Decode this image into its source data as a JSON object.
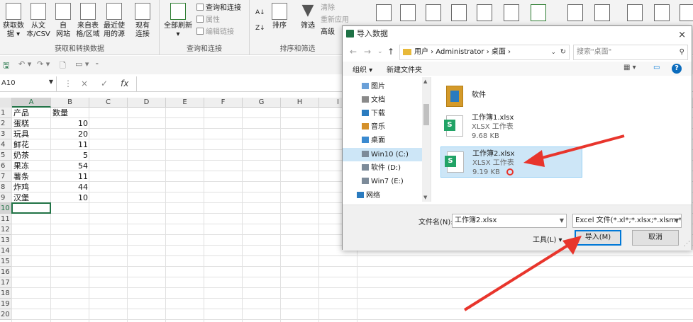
{
  "ribbon": {
    "get_transform": {
      "buttons": [
        {
          "label1": "获取数",
          "label2": "据 ▾"
        },
        {
          "label1": "从文",
          "label2": "本/CSV"
        },
        {
          "label1": "自",
          "label2": "网站"
        },
        {
          "label1": "来自表",
          "label2": "格/区域"
        },
        {
          "label1": "最近使",
          "label2": "用的源"
        },
        {
          "label1": "现有",
          "label2": "连接"
        }
      ],
      "label": "获取和转换数据"
    },
    "queries": {
      "refresh1": "全部刷新",
      "refresh2": "▾",
      "items": [
        "查询和连接",
        "属性",
        "编辑链接"
      ],
      "label": "查询和连接"
    },
    "sort_filter": {
      "sort": "排序",
      "filter": "筛选",
      "clear": "清除",
      "reapply": "重新应用",
      "advanced": "高级",
      "label": "排序和筛选"
    }
  },
  "quick_access": {
    "save": "🖫",
    "undo": "↶ ▾",
    "redo": "↷ ▾",
    "preview": "🗋",
    "more": "▭ ▾",
    "customize": "⁃"
  },
  "formula_bar": {
    "name_box": "A10",
    "cancel": "×",
    "enter": "✓",
    "fx": "fx",
    "value": ""
  },
  "sheet": {
    "columns": [
      "A",
      "B",
      "C",
      "D",
      "E",
      "F",
      "G",
      "H",
      "I"
    ],
    "selected_col": "A",
    "rows": [
      {
        "n": "1",
        "a": "产品",
        "b": "数量"
      },
      {
        "n": "2",
        "a": "蛋糕",
        "b": "10"
      },
      {
        "n": "3",
        "a": "玩具",
        "b": "20"
      },
      {
        "n": "4",
        "a": "鲜花",
        "b": "11"
      },
      {
        "n": "5",
        "a": "奶茶",
        "b": "5"
      },
      {
        "n": "6",
        "a": "果冻",
        "b": "54"
      },
      {
        "n": "7",
        "a": "薯条",
        "b": "11"
      },
      {
        "n": "8",
        "a": "炸鸡",
        "b": "44"
      },
      {
        "n": "9",
        "a": "汉堡",
        "b": "10"
      },
      {
        "n": "10",
        "a": "",
        "b": ""
      },
      {
        "n": "11",
        "a": "",
        "b": ""
      },
      {
        "n": "12",
        "a": "",
        "b": ""
      },
      {
        "n": "13",
        "a": "",
        "b": ""
      },
      {
        "n": "14",
        "a": "",
        "b": ""
      },
      {
        "n": "15",
        "a": "",
        "b": ""
      },
      {
        "n": "16",
        "a": "",
        "b": ""
      },
      {
        "n": "17",
        "a": "",
        "b": ""
      },
      {
        "n": "18",
        "a": "",
        "b": ""
      },
      {
        "n": "19",
        "a": "",
        "b": ""
      },
      {
        "n": "20",
        "a": "",
        "b": ""
      }
    ],
    "selected_row": "10"
  },
  "dialog": {
    "title": "导入数据",
    "close": "×",
    "nav": {
      "back": "←",
      "forward": "→",
      "dropdown": "⌄",
      "up": "↑"
    },
    "breadcrumb": "用户 › Administrator › 桌面 ›",
    "breadcrumb_dropdown": "⌄",
    "refresh": "↻",
    "search_placeholder": "搜索\"桌面\"",
    "search_icon": "⚲",
    "toolbar": {
      "organize": "组织 ▾",
      "new_folder": "新建文件夹",
      "view": "▦ ▾",
      "pane": "▭",
      "help": "?"
    },
    "nav_items": [
      {
        "label": "图片",
        "icon": "pictures-icon"
      },
      {
        "label": "文档",
        "icon": "documents-icon"
      },
      {
        "label": "下载",
        "icon": "downloads-icon"
      },
      {
        "label": "音乐",
        "icon": "music-icon"
      },
      {
        "label": "桌面",
        "icon": "desktop-icon"
      },
      {
        "label": "Win10 (C:)",
        "icon": "drive-icon"
      },
      {
        "label": "软件 (D:)",
        "icon": "drive-icon"
      },
      {
        "label": "Win7 (E:)",
        "icon": "drive-icon"
      },
      {
        "label": "网络",
        "icon": "network-icon"
      }
    ],
    "selected_nav": "Win10 (C:)",
    "files": [
      {
        "name": "软件",
        "type": "",
        "size": ""
      },
      {
        "name": "工作簿1.xlsx",
        "type": "XLSX 工作表",
        "size": "9.68 KB"
      },
      {
        "name": "工作簿2.xlsx",
        "type": "XLSX 工作表",
        "size": "9.19 KB"
      }
    ],
    "selected_file": "工作簿2.xlsx",
    "filename_label": "文件名(N):",
    "filename_value": "工作簿2.xlsx",
    "filetype_value": "Excel 文件(*.xl*;*.xlsx;*.xlsm;*.:",
    "tools_label": "工具(L) ▾",
    "import_button": "导入(M)",
    "cancel_button": "取消"
  },
  "colors": {
    "excel_green": "#217346",
    "selection_blue": "#cde6f7",
    "arrow_red": "#e8352c"
  }
}
